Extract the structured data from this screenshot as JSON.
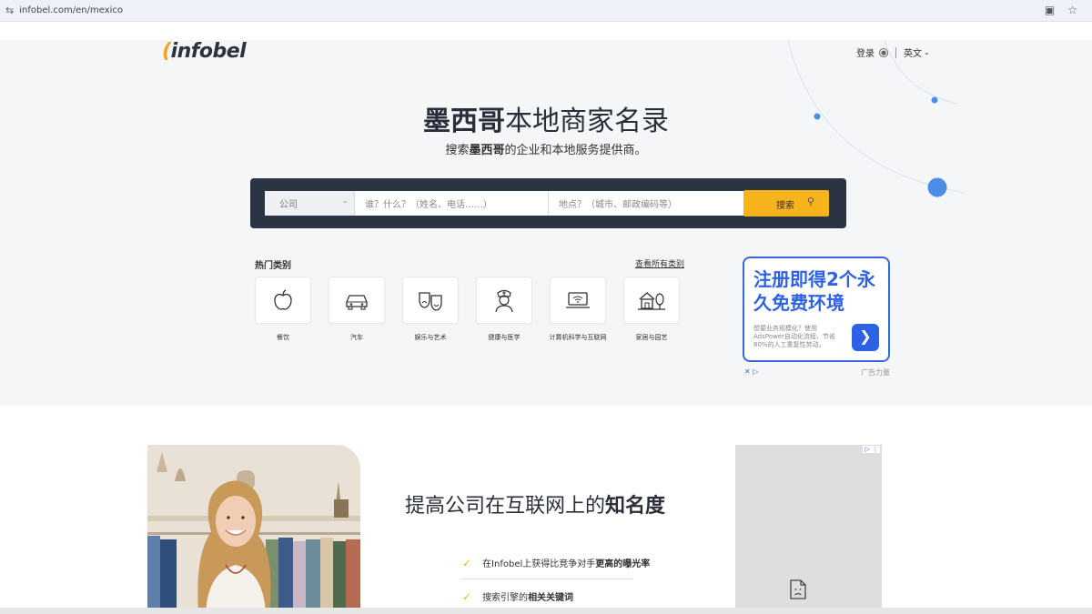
{
  "browser": {
    "url": "infobel.com/en/mexico"
  },
  "header": {
    "logo": "infobel",
    "login": "登录",
    "language": "英文"
  },
  "hero": {
    "title_bold": "墨西哥",
    "title_rest": "本地商家名录",
    "subtitle_pre": "搜索",
    "subtitle_bold": "墨西哥",
    "subtitle_post": "的企业和本地服务提供商。"
  },
  "search": {
    "category": "公司",
    "what_placeholder": "谁？什么？（姓名、电话……）",
    "where_placeholder": "地点？（城市、邮政编码等）",
    "button": "搜索"
  },
  "categories": {
    "heading": "热门类别",
    "view_all": "查看所有类别",
    "items": [
      {
        "label": "餐饮",
        "icon": "apple-icon"
      },
      {
        "label": "汽车",
        "icon": "car-icon"
      },
      {
        "label": "娱乐与艺术",
        "icon": "theater-masks-icon"
      },
      {
        "label": "健康与医学",
        "icon": "nurse-icon"
      },
      {
        "label": "计算机科学与互联网",
        "icon": "laptop-wifi-icon"
      },
      {
        "label": "家居与园艺",
        "icon": "house-garden-icon"
      }
    ]
  },
  "ad_top": {
    "title": "注册即得2个永久免费环境",
    "text": "想要业务规模化？使用AdsPower自动化流程，节省80%的人工重复性劳动。",
    "footer": "广告力量"
  },
  "promo": {
    "title_pre": "提高公司在互联网上的",
    "title_bold": "知名度",
    "items": [
      {
        "pre": "在Infobel上获得比竞争对手",
        "bold": "更高的曝光率"
      },
      {
        "pre": "搜索引擎的",
        "bold": "相关关键词"
      }
    ]
  },
  "colors": {
    "accent": "#f6b31b",
    "dark": "#2b3443",
    "ad_blue": "#2f61e6"
  }
}
